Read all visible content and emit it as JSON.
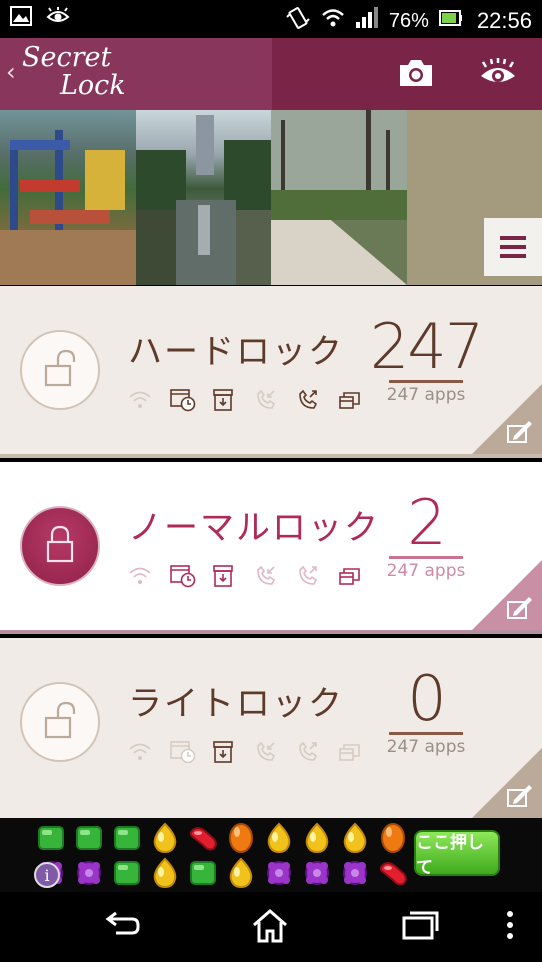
{
  "status_bar": {
    "battery_percent": "76%",
    "time": "22:56",
    "icons": [
      "gallery-icon",
      "eye-notification-icon",
      "vibrate-icon",
      "wifi-icon",
      "signal-icon",
      "battery-icon"
    ]
  },
  "header": {
    "logo_line1": "Secret",
    "logo_line2": "Lock",
    "back_glyph": "‹",
    "icons": [
      "camera-icon",
      "eye-icon"
    ]
  },
  "photos": {
    "menu_icon": "list-menu-icon"
  },
  "cards": [
    {
      "id": "hard",
      "title": "ハードロック",
      "count": "247",
      "apps_label": "247 apps",
      "locked": false,
      "features": [
        {
          "icon": "wifi-icon",
          "active": false
        },
        {
          "icon": "timer-icon",
          "active": true
        },
        {
          "icon": "archive-icon",
          "active": true
        },
        {
          "icon": "incoming-call-icon",
          "active": false
        },
        {
          "icon": "outgoing-call-icon",
          "active": true
        },
        {
          "icon": "windows-icon",
          "active": true
        }
      ]
    },
    {
      "id": "normal",
      "title": "ノーマルロック",
      "count": "2",
      "apps_label": "247 apps",
      "locked": true,
      "features": [
        {
          "icon": "wifi-icon",
          "active": false
        },
        {
          "icon": "timer-icon",
          "active": true
        },
        {
          "icon": "archive-icon",
          "active": true
        },
        {
          "icon": "incoming-call-icon",
          "active": false
        },
        {
          "icon": "outgoing-call-icon",
          "active": false
        },
        {
          "icon": "windows-icon",
          "active": true
        }
      ]
    },
    {
      "id": "light",
      "title": "ライトロック",
      "count": "0",
      "apps_label": "247 apps",
      "locked": false,
      "features": [
        {
          "icon": "wifi-icon",
          "active": false
        },
        {
          "icon": "timer-icon",
          "active": false
        },
        {
          "icon": "archive-icon",
          "active": true
        },
        {
          "icon": "incoming-call-icon",
          "active": false
        },
        {
          "icon": "outgoing-call-icon",
          "active": false
        },
        {
          "icon": "windows-icon",
          "active": false
        }
      ]
    }
  ],
  "ad": {
    "cta_label": "ここ押して",
    "info_glyph": "i"
  },
  "colors": {
    "brand": "#7a2448",
    "accent_pink": "#b02a58",
    "text_brown": "#5e3a2a",
    "card_bg": "#f0ebe6"
  }
}
